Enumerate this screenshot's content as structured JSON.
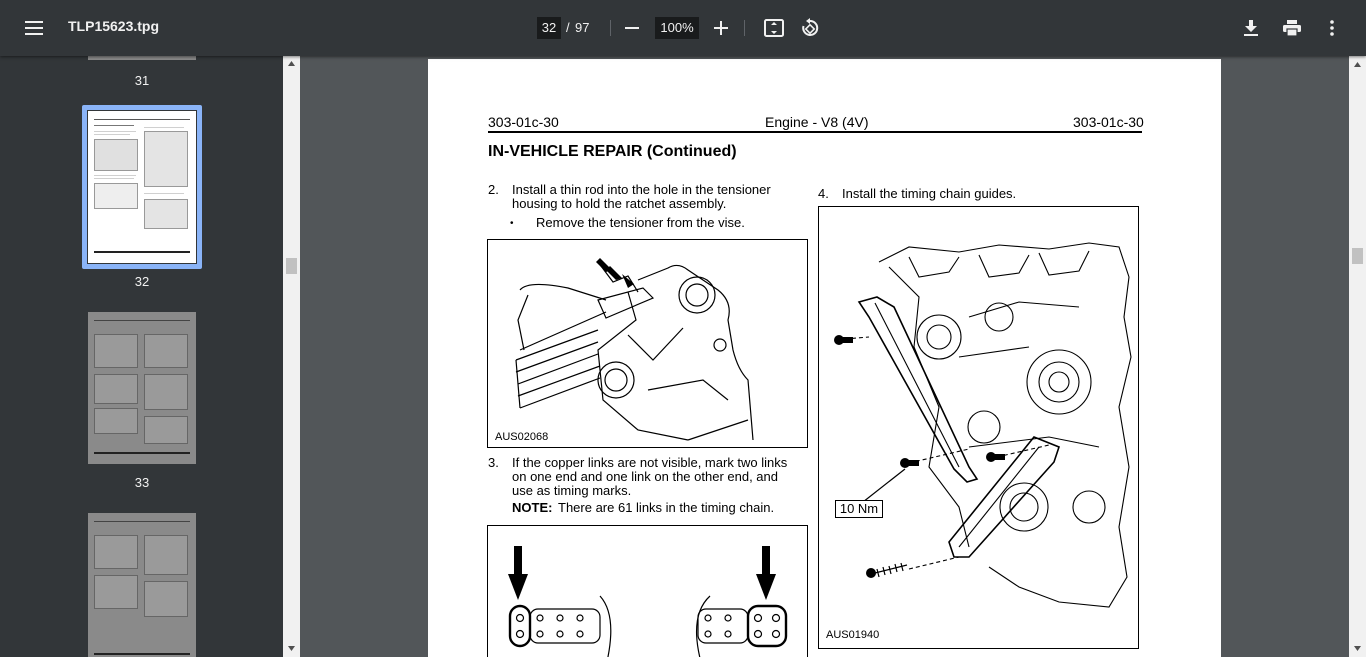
{
  "toolbar": {
    "title": "TLP15623.tpg",
    "current_page": "32",
    "page_separator": "/",
    "total_pages": "97",
    "zoom": "100%",
    "icons": [
      "menu-icon",
      "zoom-out-icon",
      "zoom-in-icon",
      "fit-page-icon",
      "rotate-icon",
      "download-icon",
      "print-icon",
      "more-vert-icon"
    ]
  },
  "sidebar": {
    "thumbnails": [
      {
        "label": "31"
      },
      {
        "label": "32"
      },
      {
        "label": "33"
      },
      {
        "label": ""
      }
    ],
    "active_page": "32"
  },
  "document": {
    "header_left": "303-01c-30",
    "header_center": "Engine - V8 (4V)",
    "header_right": "303-01c-30",
    "section_title": "IN-VEHICLE REPAIR (Continued)",
    "step2_num": "2.",
    "step2_line1": "Install a thin rod into the hole in the tensioner",
    "step2_line2": "housing to hold the ratchet assembly.",
    "step2_bullet": "Remove the tensioner from the vise.",
    "fig1_id": "AUS02068",
    "step3_num": "3.",
    "step3_line1": "If the copper links are not visible, mark two links",
    "step3_line2": "on one end and one link on the other end, and",
    "step3_line3": "use as timing marks.",
    "note_label": "NOTE:",
    "note_text": "There are 61 links in the timing chain.",
    "step4_num": "4.",
    "step4_text": "Install the timing chain guides.",
    "torque_label": "10 Nm",
    "fig2_id": "AUS01940"
  }
}
